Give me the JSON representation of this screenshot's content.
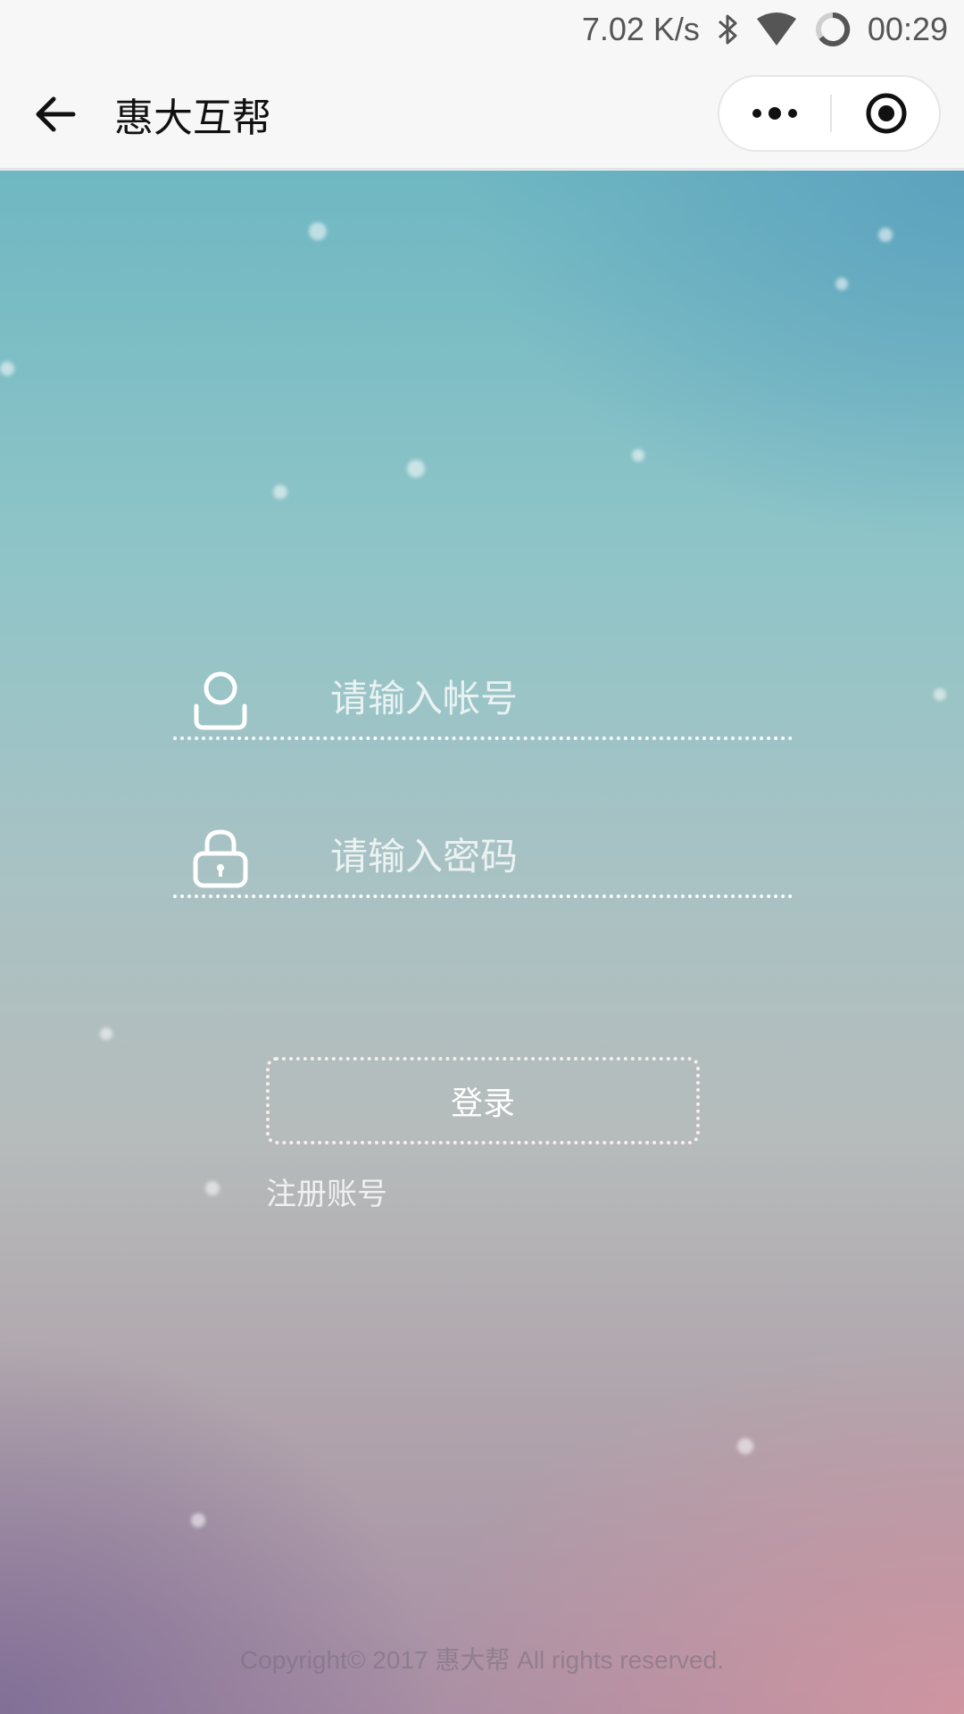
{
  "status_bar": {
    "speed": "7.02 K/s",
    "time": "00:29",
    "icons": [
      "bluetooth-icon",
      "wifi-icon",
      "battery-ring-icon"
    ]
  },
  "nav": {
    "title": "惠大互帮",
    "back_icon": "arrow-left-icon",
    "more_icon": "more-dots-icon",
    "close_icon": "target-circle-icon"
  },
  "form": {
    "account": {
      "placeholder": "请输入帐号",
      "value": "",
      "icon": "user-icon"
    },
    "password": {
      "placeholder": "请输入密码",
      "value": "",
      "icon": "lock-icon"
    },
    "login_label": "登录",
    "register_label": "注册账号"
  },
  "footer": {
    "copyright": "Copyright© 2017 惠大帮 All rights reserved."
  },
  "colors": {
    "bg_top": "#6fb7c2",
    "bg_bottom_right": "#d696a0",
    "bg_bottom_left": "#806e96",
    "bar": "#f7f7f7"
  }
}
